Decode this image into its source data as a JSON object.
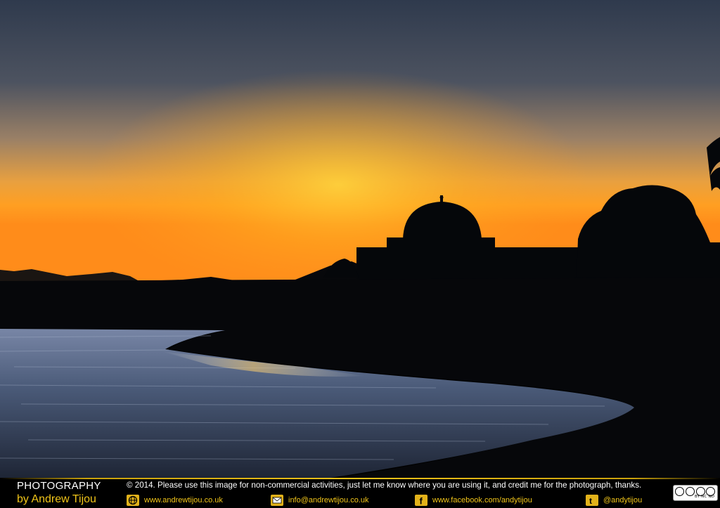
{
  "photo": {
    "subject": "Sunset silhouette of a domed building beside water",
    "colors": {
      "sky_top": "#2f3a4d",
      "sky_glow": "#ffb52a",
      "horizon": "#ff9a20",
      "silhouette": "#05070a",
      "water": "#4a5a78"
    }
  },
  "footer": {
    "brand_line1": "PHOTOGRAPHY",
    "brand_line2": "by Andrew Tijou",
    "notice": "© 2014. Please use this image for non-commercial activities, just let me know where you are using it, and credit me for the photograph, thanks.",
    "contacts": [
      {
        "icon": "globe-icon",
        "label": "www.andrewtijou.co.uk"
      },
      {
        "icon": "mail-icon",
        "label": "info@andrewtijou.co.uk"
      },
      {
        "icon": "facebook-icon",
        "label": "www.facebook.com/andytijou"
      },
      {
        "icon": "twitter-icon",
        "label": "@andytijou"
      }
    ],
    "license_badge": "BY NC ND",
    "accent_color": "#f0c419"
  }
}
